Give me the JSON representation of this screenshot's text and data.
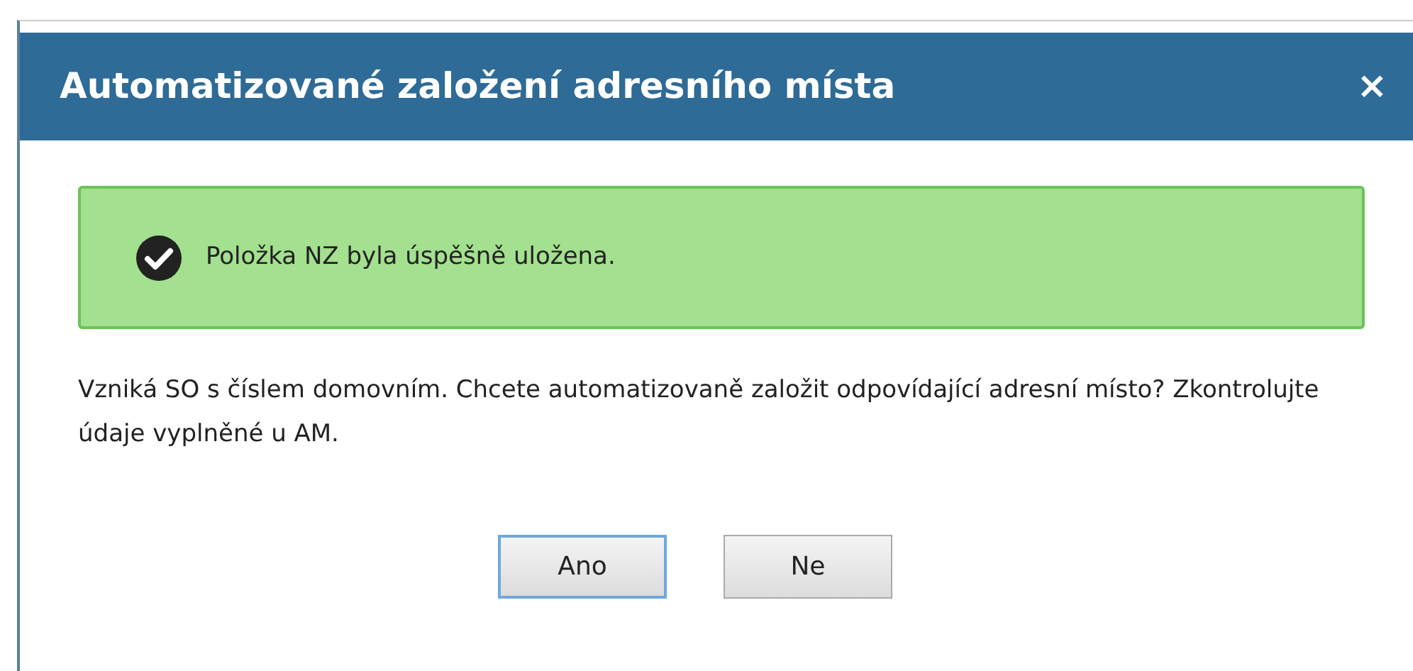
{
  "dialog": {
    "title": "Automatizované založení adresního místa",
    "close": "×"
  },
  "alert": {
    "kind": "success",
    "text": "Položka NZ byla úspěšně uložena."
  },
  "message": "Vzniká SO s číslem domovním. Chcete automatizovaně založit odpovídající adresní místo? Zkontrolujte údaje vyplněné u AM.",
  "buttons": [
    {
      "label": "Ano",
      "focused": true
    },
    {
      "label": "Ne",
      "focused": false
    }
  ]
}
